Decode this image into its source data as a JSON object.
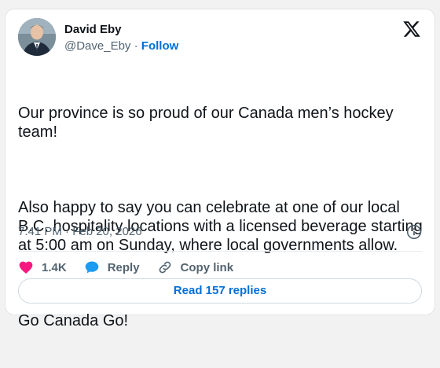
{
  "author": {
    "name": "David Eby",
    "handle": "@Dave_Eby",
    "separator": "·",
    "follow_label": "Follow"
  },
  "post": {
    "paragraphs": [
      "Our province is so proud of our Canada men’s hockey team!",
      "Also happy to say you can celebrate at one of our local B.C. hospitality locations with a licensed beverage starting at 5:00 am on Sunday, where local governments allow.",
      "Go Canada Go!"
    ],
    "timestamp": "7:41 PM · Feb 20, 2026"
  },
  "actions": {
    "like_count": "1.4K",
    "reply_label": "Reply",
    "copy_link_label": "Copy link"
  },
  "footer": {
    "read_replies_label": "Read 157 replies"
  },
  "icons": {
    "logo": "x-logo-icon",
    "info": "info-icon",
    "like": "heart-icon",
    "reply": "speech-bubble-icon",
    "copy": "link-icon"
  },
  "colors": {
    "heart": "#f91880",
    "reply_bubble": "#1d9bf0",
    "link_blue": "#006fd6"
  }
}
